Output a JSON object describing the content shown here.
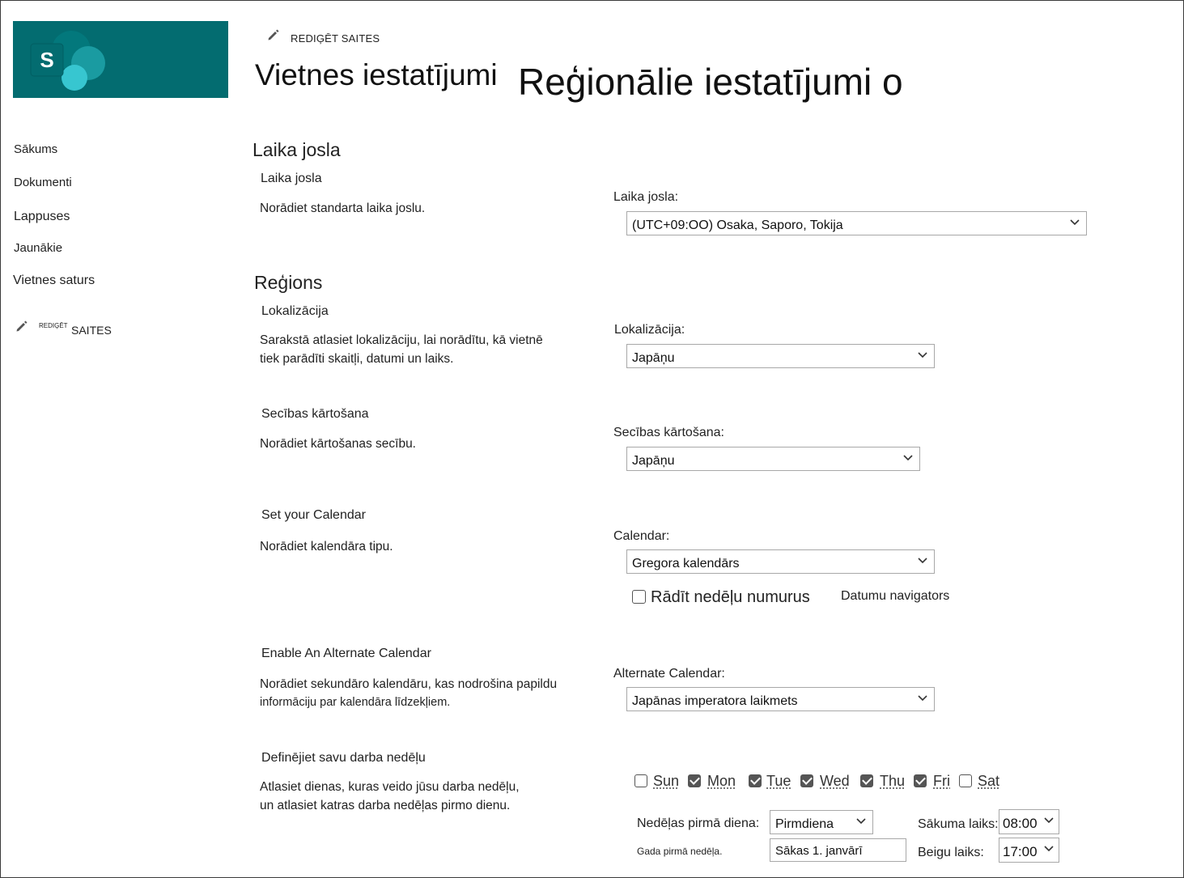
{
  "header": {
    "edit_links_label": "REDIĢĒT SAITES",
    "title_part1": "Vietnes iestatījumi",
    "title_part2": "Reģionālie iestatījumi o"
  },
  "nav": {
    "items": [
      "Sākums",
      "Dokumenti",
      "Lappuses",
      "Jaunākie",
      "Vietnes saturs"
    ],
    "edit_prefix": "REDIĢĒT",
    "edit_suffix": "SAITES"
  },
  "timezone": {
    "section_title": "Laika josla",
    "subtitle": "Laika josla",
    "description": "Norādiet standarta laika joslu.",
    "field_label": "Laika josla:",
    "value": "(UTC+09:OO) Osaka, Saporo, Tokija"
  },
  "region": {
    "section_title": "Reģions",
    "locale": {
      "subtitle": "Lokalizācija",
      "description_line1": "Sarakstā atlasiet lokalizāciju, lai norādītu, kā vietnē",
      "description_line2": "tiek parādīti skaitļi, datumi un laiks.",
      "field_label": "Lokalizācija:",
      "value": "Japāņu"
    },
    "sort": {
      "subtitle": "Secības kārtošana",
      "description": "Norādiet kārtošanas secību.",
      "field_label": "Secības kārtošana:",
      "value": "Japāņu"
    },
    "calendar": {
      "subtitle": "Set your Calendar",
      "description": "Norādiet kalendāra tipu.",
      "field_label": "Calendar:",
      "value": "Gregora kalendārs",
      "show_week_numbers_label": "Rādīt nedēļu numurus",
      "show_week_numbers_checked": false,
      "date_navigator_label": "Datumu navigators"
    },
    "alt_calendar": {
      "subtitle": "Enable An Alternate Calendar",
      "description_line1": "Norādiet sekundāro kalendāru, kas nodrošina papildu",
      "description_line2": "informāciju par kalendāra līdzekļiem.",
      "field_label": "Alternate Calendar:",
      "value": "Japānas imperatora laikmets"
    },
    "work_week": {
      "subtitle": "Definējiet savu darba nedēļu",
      "description_line1": "Atlasiet dienas, kuras veido jūsu darba nedēļu,",
      "description_line2": "un atlasiet katras darba nedēļas pirmo dienu.",
      "days": [
        {
          "label": "Sun",
          "checked": false
        },
        {
          "label": "Mon",
          "checked": true
        },
        {
          "label": "Tue",
          "checked": true
        },
        {
          "label": "Wed",
          "checked": true
        },
        {
          "label": "Thu",
          "checked": true
        },
        {
          "label": "Fri",
          "checked": true
        },
        {
          "label": "Sat",
          "checked": false
        }
      ],
      "first_day_label": "Nedēļas pirmā diena:",
      "first_day_value": "Pirmdiena",
      "first_week_label": "Gada pirmā nedēļa.",
      "first_week_value": "Sākas 1. janvārī",
      "start_time_label": "Sākuma laiks:",
      "start_time_value": "08:00",
      "end_time_label": "Beigu laiks:",
      "end_time_value": "17:00"
    }
  },
  "colors": {
    "logo_bg": "#036c70",
    "logo_dark": "#03787c",
    "logo_mid": "#1a9ba1",
    "logo_light": "#37c6d0"
  }
}
